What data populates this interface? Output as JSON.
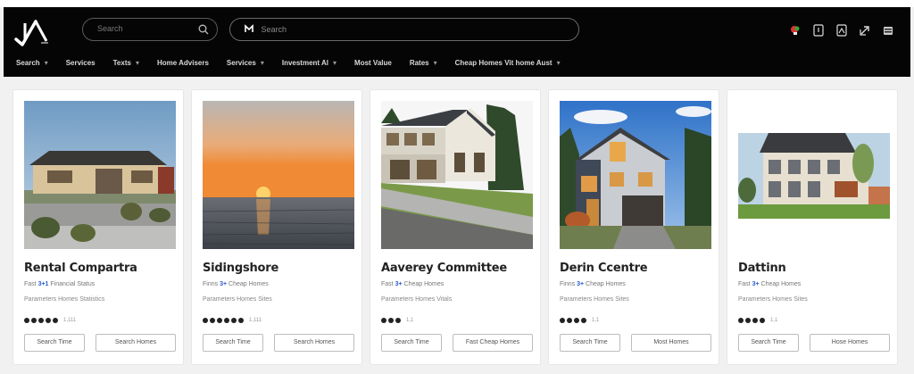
{
  "app": {
    "logo": "logo-mark"
  },
  "header": {
    "search_placeholder": "Search",
    "location_placeholder": "Search",
    "icons": [
      "notification-icon",
      "bookmark-icon",
      "image-icon",
      "share-icon",
      "menu-icon"
    ]
  },
  "nav": {
    "items": [
      {
        "label": "Search",
        "has_menu": true
      },
      {
        "label": "Services",
        "has_menu": false
      },
      {
        "label": "Texts",
        "has_menu": true
      },
      {
        "label": "Home Advisers",
        "has_menu": false
      },
      {
        "label": "Services",
        "has_menu": true
      },
      {
        "label": "Investment Al",
        "has_menu": true
      },
      {
        "label": "Most Value",
        "has_menu": false
      },
      {
        "label": "Rates",
        "has_menu": true
      },
      {
        "label": "Cheap Homes Vit home Aust",
        "has_menu": true
      }
    ]
  },
  "listings": [
    {
      "title": "Rental Compartra",
      "detail_prefix": "Fast",
      "detail_highlight": "3+1",
      "detail_rest": "Financial Status",
      "subdetail": "Parameters Homes Statistics",
      "rating": 5,
      "rating_count": "1,111",
      "action_primary": "Search Time",
      "action_secondary": "Search Homes"
    },
    {
      "title": "Sidingshore",
      "detail_prefix": "Finns",
      "detail_highlight": "3+",
      "detail_rest": "Cheap Homes",
      "subdetail": "Parameters Homes Sites",
      "rating": 6,
      "rating_count": "1,111",
      "action_primary": "Search Time",
      "action_secondary": "Search Homes"
    },
    {
      "title": "Aaverey Committee",
      "detail_prefix": "Fast",
      "detail_highlight": "3+",
      "detail_rest": "Cheap Homes",
      "subdetail": "Parameters Homes Vitals",
      "rating": 3,
      "rating_count": "1,1",
      "action_primary": "Search Time",
      "action_secondary": "Fast Cheap Homes"
    },
    {
      "title": "Derin Ccentre",
      "detail_prefix": "Finns",
      "detail_highlight": "3+",
      "detail_rest": "Cheap Homes",
      "subdetail": "Parameters Homes Sites",
      "rating": 4,
      "rating_count": "1,1",
      "action_primary": "Search Time",
      "action_secondary": "Most Homes"
    },
    {
      "title": "Dattinn",
      "detail_prefix": "Fast",
      "detail_highlight": "3+",
      "detail_rest": "Cheap Homes",
      "subdetail": "Parameters Homes Sites",
      "rating": 4,
      "rating_count": "1,1",
      "action_primary": "Search Time",
      "action_secondary": "Hose Homes"
    }
  ],
  "colors": {
    "header_bg": "#050505",
    "accent": "#2a5ccf",
    "page_bg": "#f1f1f1"
  }
}
